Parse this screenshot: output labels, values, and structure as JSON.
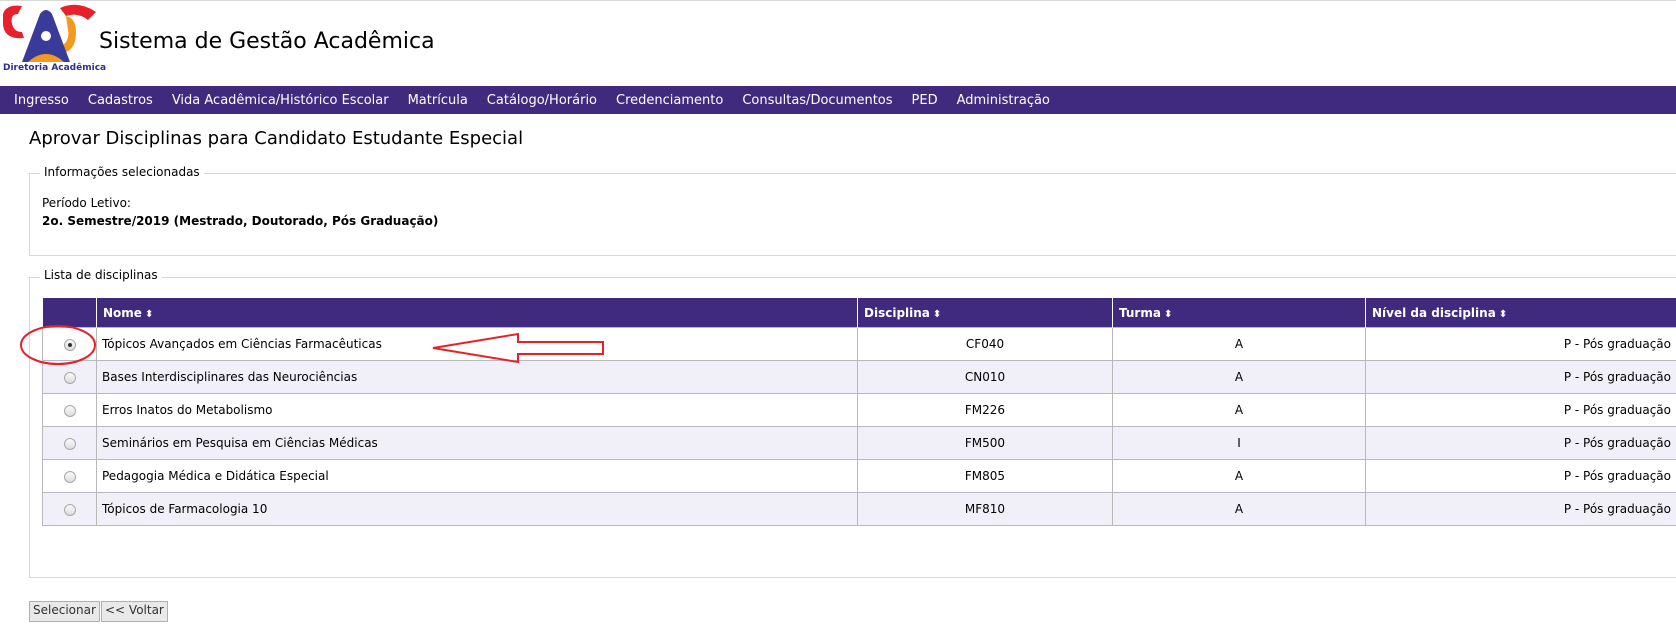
{
  "header": {
    "logo_caption": "Diretoria Acadêmica",
    "app_title": "Sistema de Gestão Acadêmica"
  },
  "nav": {
    "items": [
      {
        "label": "Ingresso"
      },
      {
        "label": "Cadastros"
      },
      {
        "label": "Vida Acadêmica/Histórico Escolar"
      },
      {
        "label": "Matrícula"
      },
      {
        "label": "Catálogo/Horário"
      },
      {
        "label": "Credenciamento"
      },
      {
        "label": "Consultas/Documentos"
      },
      {
        "label": "PED"
      },
      {
        "label": "Administração"
      }
    ]
  },
  "page": {
    "title": "Aprovar Disciplinas para Candidato Estudante Especial"
  },
  "info": {
    "legend": "Informações selecionadas",
    "periodo_label": "Período Letivo:",
    "periodo_value": "2o. Semestre/2019 (Mestrado, Doutorado, Pós Graduação)"
  },
  "list": {
    "legend": "Lista de disciplinas",
    "columns": {
      "nome": "Nome",
      "disciplina": "Disciplina",
      "turma": "Turma",
      "nivel": "Nível da disciplina"
    },
    "rows": [
      {
        "nome": "Tópicos Avançados em Ciências Farmacêuticas",
        "disciplina": "CF040",
        "turma": "A",
        "nivel": "P - Pós graduação",
        "selected": true
      },
      {
        "nome": "Bases Interdisciplinares das Neurociências",
        "disciplina": "CN010",
        "turma": "A",
        "nivel": "P - Pós graduação",
        "selected": false
      },
      {
        "nome": "Erros Inatos do Metabolismo",
        "disciplina": "FM226",
        "turma": "A",
        "nivel": "P - Pós graduação",
        "selected": false
      },
      {
        "nome": "Seminários em Pesquisa em Ciências Médicas",
        "disciplina": "FM500",
        "turma": "I",
        "nivel": "P - Pós graduação",
        "selected": false
      },
      {
        "nome": "Pedagogia Médica e Didática Especial",
        "disciplina": "FM805",
        "turma": "A",
        "nivel": "P - Pós graduação",
        "selected": false
      },
      {
        "nome": "Tópicos de Farmacologia 10",
        "disciplina": "MF810",
        "turma": "A",
        "nivel": "P - Pós graduação",
        "selected": false
      }
    ]
  },
  "buttons": {
    "selecionar": "Selecionar",
    "voltar": "<< Voltar"
  },
  "icons": {
    "sort": "sort-updown-icon",
    "logo": "diretoria-academica-logo"
  },
  "colors": {
    "navbar": "#3f2a7d",
    "row_alt": "#f1f0f8",
    "annotation": "#e8202a"
  }
}
